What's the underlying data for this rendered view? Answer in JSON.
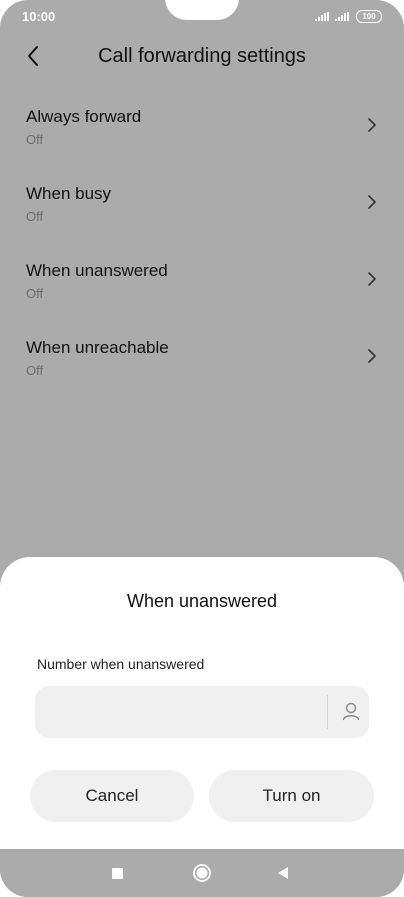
{
  "status_bar": {
    "time": "10:00",
    "battery": "100",
    "signal_icons": [
      "signal-icon",
      "signal-icon"
    ]
  },
  "header": {
    "title": "Call forwarding settings",
    "back_icon": "chevron-left-icon"
  },
  "settings": [
    {
      "label": "Always forward",
      "value": "Off"
    },
    {
      "label": "When busy",
      "value": "Off"
    },
    {
      "label": "When unanswered",
      "value": "Off"
    },
    {
      "label": "When unreachable",
      "value": "Off"
    }
  ],
  "dialog": {
    "title": "When unanswered",
    "field_label": "Number when unanswered",
    "field_value": "",
    "contact_icon": "person-icon",
    "cancel_label": "Cancel",
    "confirm_label": "Turn on"
  },
  "nav_bar": {
    "icons": [
      "square-icon",
      "circle-icon",
      "triangle-back-icon"
    ]
  },
  "colors": {
    "scrim": "#ababab",
    "sheet": "#ffffff",
    "button_bg": "#f0f0f0",
    "field_bg": "#f0f0f0"
  }
}
